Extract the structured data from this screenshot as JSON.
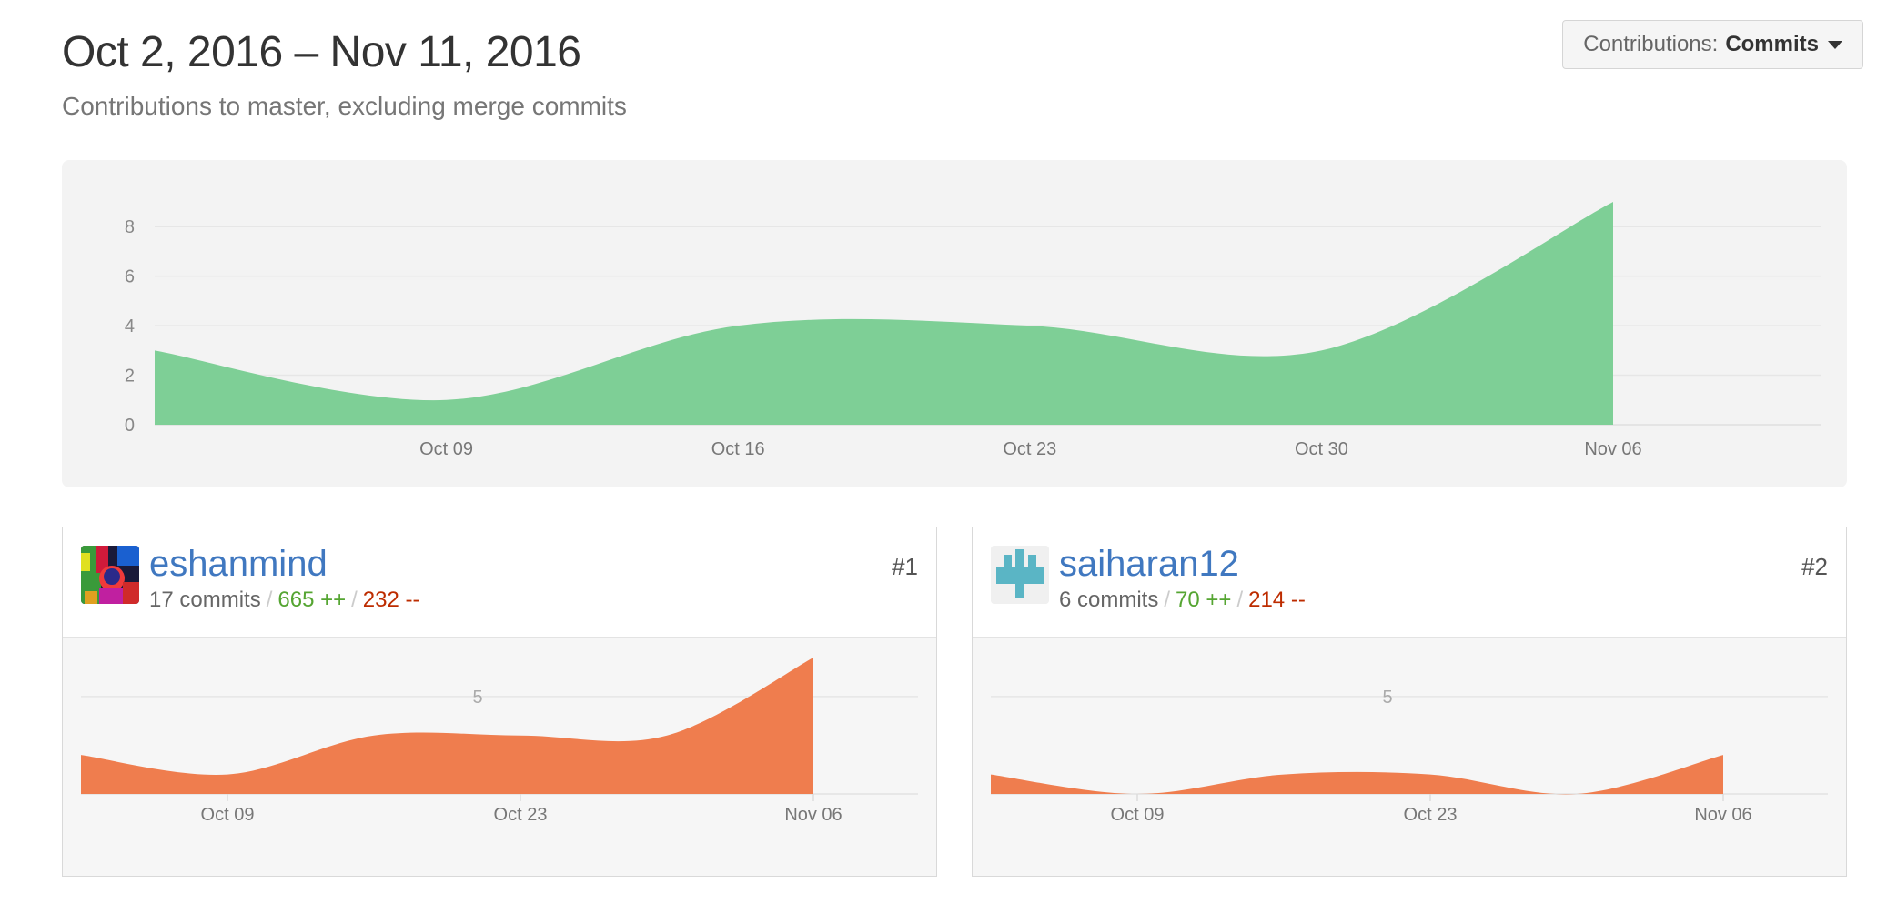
{
  "header": {
    "title": "Oct 2, 2016 – Nov 11, 2016",
    "subtitle": "Contributions to master, excluding merge commits"
  },
  "dropdown": {
    "label": "Contributions:",
    "value": "Commits",
    "icon": "caret-down-icon"
  },
  "chart_data": [
    {
      "type": "area",
      "title": "",
      "x": [
        "2016-10-02",
        "2016-10-09",
        "2016-10-16",
        "2016-10-23",
        "2016-10-30",
        "2016-11-06"
      ],
      "series": [
        {
          "values": [
            3,
            1,
            4,
            4,
            3,
            9
          ],
          "color": "#7ecf96"
        }
      ],
      "ylim": [
        0,
        9
      ],
      "yticks": [
        0,
        2,
        4,
        6,
        8
      ],
      "xtick_labels": [
        "Oct 09",
        "Oct 16",
        "Oct 23",
        "Oct 30",
        "Nov 06"
      ],
      "grid": true
    },
    {
      "type": "area",
      "title": "eshanmind",
      "x": [
        "2016-10-02",
        "2016-10-09",
        "2016-10-16",
        "2016-10-23",
        "2016-10-30",
        "2016-11-06"
      ],
      "series": [
        {
          "values": [
            2,
            1,
            3,
            3,
            3,
            7
          ],
          "color": "#ef7d4e"
        }
      ],
      "ylim": [
        0,
        7
      ],
      "yticks": [
        5
      ],
      "xtick_labels": [
        "Oct 09",
        "Oct 23",
        "Nov 06"
      ],
      "grid": true
    },
    {
      "type": "area",
      "title": "saiharan12",
      "x": [
        "2016-10-02",
        "2016-10-09",
        "2016-10-16",
        "2016-10-23",
        "2016-10-30",
        "2016-11-06"
      ],
      "series": [
        {
          "values": [
            1,
            0,
            1,
            1,
            0,
            2
          ],
          "color": "#ef7d4e"
        }
      ],
      "ylim": [
        0,
        7
      ],
      "yticks": [
        5
      ],
      "xtick_labels": [
        "Oct 09",
        "Oct 23",
        "Nov 06"
      ],
      "grid": true
    }
  ],
  "contributors": [
    {
      "name": "eshanmind",
      "rank": "#1",
      "commits": "17 commits",
      "additions": "665 ++",
      "deletions": "232 --",
      "sep": "/",
      "avatar": "avatar-image"
    },
    {
      "name": "saiharan12",
      "rank": "#2",
      "commits": "6 commits",
      "additions": "70 ++",
      "deletions": "214 --",
      "sep": "/",
      "avatar": "identicon-avatar"
    }
  ]
}
